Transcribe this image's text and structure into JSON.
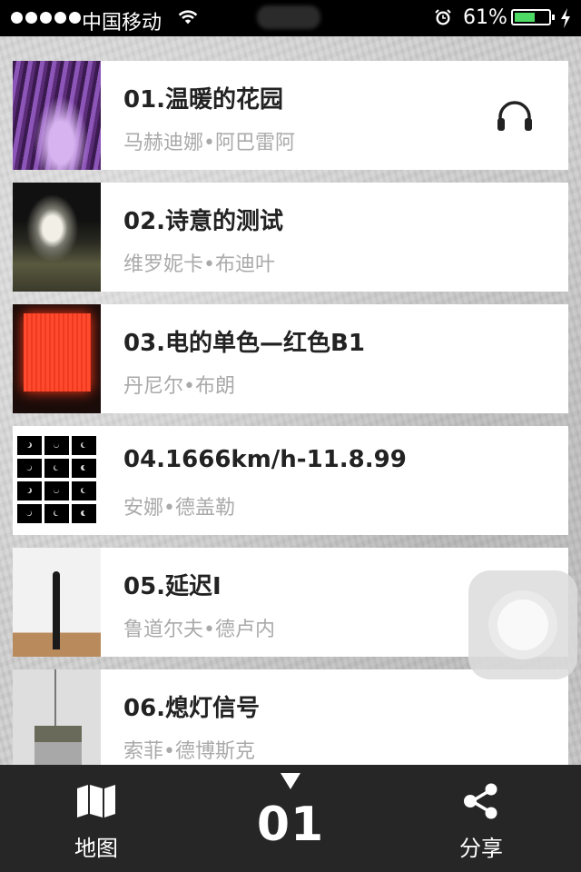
{
  "status_bar": {
    "carrier": "中国移动",
    "battery_percent_text": "61%",
    "battery_level": 0.61
  },
  "tracks": [
    {
      "title": "01.温暖的花园",
      "artist": "马赫迪娜•阿巴雷阿",
      "icon": "headphone-icon"
    },
    {
      "title": "02.诗意的测试",
      "artist": "维罗妮卡•布迪叶"
    },
    {
      "title": "03.电的单色—红色B1",
      "artist": "丹尼尔•布朗"
    },
    {
      "title": "04.1666km/h-11.8.99",
      "artist": "安娜•德盖勒"
    },
    {
      "title": "05.延迟I",
      "artist": "鲁道尔夫•德卢内"
    },
    {
      "title": "06.熄灯信号",
      "artist": "索菲•德博斯克"
    }
  ],
  "bottom_bar": {
    "map_label": "地图",
    "current_index": "01",
    "share_label": "分享"
  }
}
